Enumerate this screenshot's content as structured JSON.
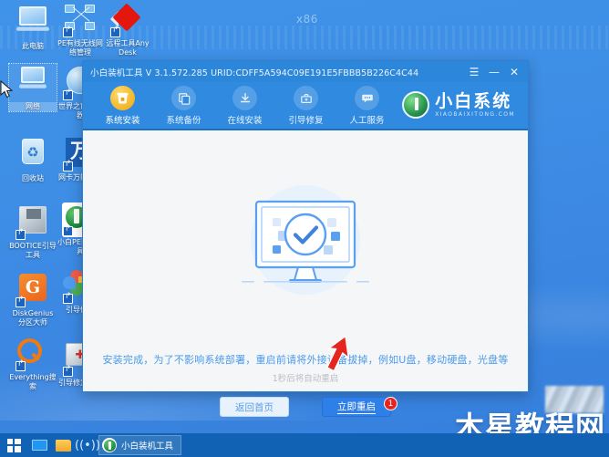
{
  "desktop": {
    "x86_label": "x86",
    "icons": [
      {
        "name": "this-pc",
        "label": "此电脑",
        "glyph": "computer-icon"
      },
      {
        "name": "pe-network-manager",
        "label": "PE有线无线网络管理",
        "glyph": "network-nodes-icon"
      },
      {
        "name": "anydesk-remote-tool",
        "label": "远程工具AnyDesk",
        "glyph": "anydesk-icon"
      },
      {
        "name": "network",
        "label": "网络",
        "glyph": "globe-monitor-icon"
      },
      {
        "name": "world-window-browser",
        "label": "世界之窗浏览器",
        "glyph": "globe-icon"
      },
      {
        "name": "recycle-bin",
        "label": "回收站",
        "glyph": "recycle-bin-icon"
      },
      {
        "name": "nic-universal-driver",
        "label": "网卡万能驱动",
        "glyph": "wan-icon"
      },
      {
        "name": "bootice-tool",
        "label": "BOOTICE引导工具",
        "glyph": "floppy-icon"
      },
      {
        "name": "xiaobai-pe-installer",
        "label": "小白PE装机工具",
        "glyph": "xiaobai-icon"
      },
      {
        "name": "diskgenius",
        "label": "DiskGenius分区大师",
        "glyph": "diskgenius-icon"
      },
      {
        "name": "boot-repair",
        "label": "引导修复",
        "glyph": "flower-icon"
      },
      {
        "name": "everything-search",
        "label": "Everything搜索",
        "glyph": "magnifier-icon"
      },
      {
        "name": "boot-repair-tool",
        "label": "引导修复工具",
        "glyph": "toolbox-icon"
      }
    ]
  },
  "taskbar": {
    "start_label": "start",
    "items": [
      {
        "name": "taskbar-display",
        "label": ""
      },
      {
        "name": "taskbar-explorer",
        "label": ""
      },
      {
        "name": "taskbar-wifi",
        "label": ""
      }
    ],
    "active_task": "小白装机工具"
  },
  "window": {
    "title": "小白装机工具 V 3.1.572.285 URID:CDFF5A594C09E191E5FBBB5B226C4C44",
    "controls": {
      "menu": "☰",
      "minimize": "—",
      "close": "✕"
    },
    "nav": [
      {
        "name": "tab-system-install",
        "label": "系统安装",
        "icon": "bucket-icon",
        "active": true
      },
      {
        "name": "tab-system-backup",
        "label": "系统备份",
        "icon": "copy-icon",
        "active": false
      },
      {
        "name": "tab-online-install",
        "label": "在线安装",
        "icon": "download-icon",
        "active": false
      },
      {
        "name": "tab-boot-repair",
        "label": "引导修复",
        "icon": "toolbox-icon",
        "active": false
      },
      {
        "name": "tab-manual-service",
        "label": "人工服务",
        "icon": "chat-icon",
        "active": false
      }
    ],
    "brand": {
      "name": "小白系统",
      "domain": "XIAOBAIXITONG.COM"
    },
    "content": {
      "illustration": "monitor-check-icon",
      "message": "安装完成，为了不影响系统部署，重启前请将外接设备拔掉，例如U盘，移动硬盘，光盘等",
      "countdown": "1秒后将自动重启",
      "buttons": [
        {
          "name": "return-home-button",
          "label": "返回首页",
          "style": "ghost"
        },
        {
          "name": "restart-now-button",
          "label": "立即重启",
          "style": "primary",
          "badge": "1"
        }
      ]
    }
  },
  "watermark": {
    "text": "木星教程网"
  },
  "colors": {
    "desktop_blue": "#3e8ee6",
    "titlebar_blue": "#2c86d9",
    "nav_blue": "#2f8ae0",
    "accent_blue": "#2f7fe8",
    "message_blue": "#4a9bec",
    "badge_red": "#e5251f",
    "taskbar_blue": "#1162b5",
    "active_tab_gold": "#f3b629"
  }
}
